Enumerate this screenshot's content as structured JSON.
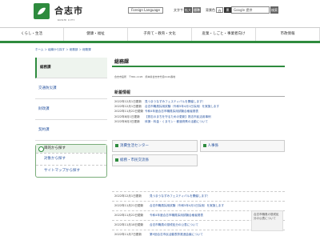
{
  "header": {
    "site_name": "合志市",
    "site_sub": "KOSHI CITY",
    "lang_label": "Foreign Language",
    "fontsize_label": "文字サイズ",
    "fontsize_btn1": "拡大",
    "fontsize_btn2": "標準",
    "bg_label": "背景色",
    "bg_btn1": "白",
    "bg_btn2": "黒",
    "search_placeholder": "Google 提供",
    "search_btn": "検索"
  },
  "gnav": [
    "くらし・生活",
    "健康・福祉",
    "子育て・教育・文化",
    "産業・しごと・事業者向け",
    "市政情報"
  ],
  "breadcrumb": "ホーム ＞ 組織から探す ＞ 総務部 ＞ 総務課",
  "sidebar": {
    "items": [
      "総務課",
      "交通防災課",
      "財政課",
      "契約課"
    ]
  },
  "purpose": {
    "title": "目的から探す",
    "items": [
      "対象から探す",
      "サイトマップから探す"
    ]
  },
  "main": {
    "title": "総務課",
    "address": "合志市役所　〒861-1195　熊本県合志市竹迫2140番地",
    "news_title": "新着情報",
    "news": [
      {
        "date": "2022年12月1日更新",
        "text": "見つまうなずみフェスティバルを開催します！"
      },
      {
        "date": "2022年12月1日更新",
        "text": "合志市職員採用試験（令和5年4月1日採用）を実施します"
      },
      {
        "date": "2022年11月22日更新",
        "text": "令和4年度合志市職員採用試験合格者発表"
      },
      {
        "date": "2022年8月1日更新",
        "text": "【熟志のまちを守るための更新】熟志市民活用事例"
      },
      {
        "date": "2022年8月2日更新",
        "text": "体操・料金・くまモン・都道府県の活動について"
      }
    ],
    "boxes": [
      "消費生活センター",
      "人事係",
      "総務・市民交流係"
    ]
  },
  "list2": [
    {
      "date": "2022年12月1日更新",
      "text": "見つまうなずみフェスティバルを開催します！"
    },
    {
      "date": "2022年11月21日更新",
      "text": "合志市職員採用試験（令和5年4月1日採用）を実施します"
    },
    {
      "date": "2022年11月22日更新",
      "text": "令和4年度合志市職員採用試験合格者発表"
    },
    {
      "date": "2022年11月18日更新",
      "text": "合志市職員の懲戒処分の公表について"
    },
    {
      "date": "2022年11月7日更新",
      "text": "第9回合志市民活動表彰推進会議について"
    }
  ],
  "image_caption": "合志市職員の懲戒処分の公表について"
}
